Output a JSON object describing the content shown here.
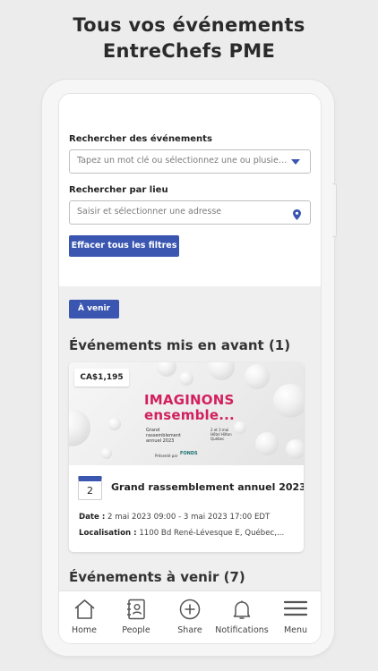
{
  "promo": {
    "line1": "Tous vos événements",
    "line2": "EntreChefs PME"
  },
  "filters": {
    "search_label": "Rechercher des événements",
    "search_placeholder": "Tapez un mot clé ou sélectionnez une ou plusieurs catégories",
    "location_label": "Rechercher par lieu",
    "location_placeholder": "Saisir et sélectionner une adresse",
    "clear_button": "Effacer tous les filtres"
  },
  "events": {
    "upcoming_tag": "À venir",
    "featured_title": "Événements mis en avant (1)",
    "upcoming_title": "Événements à venir (7)",
    "featured_card": {
      "price": "CA$1,195",
      "image_headline_1": "IMAGINONS",
      "image_headline_2": "ensemble...",
      "image_sub_1": "Grand",
      "image_sub_2": "rassemblement",
      "image_sub_3": "annuel 2023",
      "image_right_1": "2 et 3 mai",
      "image_right_2": "Hôtel Hilton",
      "image_right_3": "Québec",
      "image_presented": "Présenté par",
      "image_sponsor": "FONDS",
      "day": "2",
      "title": "Grand rassemblement annuel 2023",
      "date_label": "Date :",
      "date_value": " 2 mai 2023 09:00 - 3 mai 2023 17:00 EDT",
      "location_label": "Localisation :",
      "location_value": " 1100 Bd René-Lévesque E, Québec,..."
    }
  },
  "tabbar": [
    {
      "label": "Home",
      "icon": "home-icon"
    },
    {
      "label": "People",
      "icon": "contacts-book-icon"
    },
    {
      "label": "Share",
      "icon": "plus-circle-icon"
    },
    {
      "label": "Notifications",
      "icon": "bell-icon"
    },
    {
      "label": "Menu",
      "icon": "hamburger-menu-icon"
    }
  ],
  "colors": {
    "accent": "#3a56b0",
    "headline_pink": "#d2205f",
    "section_bg": "#efefef"
  }
}
